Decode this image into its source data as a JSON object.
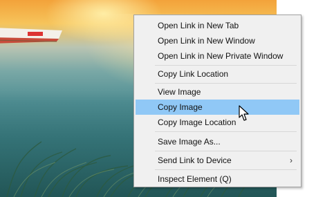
{
  "background_photo": {
    "description_color_sky": "#f3a23a",
    "description_color_water": "#3c7f84"
  },
  "context_menu": {
    "items": [
      {
        "label": "Open Link in New Tab"
      },
      {
        "label": "Open Link in New Window"
      },
      {
        "label": "Open Link in New Private Window"
      },
      {
        "label": "Copy Link Location"
      },
      {
        "label": "View Image"
      },
      {
        "label": "Copy Image",
        "highlighted": true
      },
      {
        "label": "Copy Image Location"
      },
      {
        "label": "Save Image As..."
      },
      {
        "label": "Send Link to Device",
        "submenu_arrow": "›"
      },
      {
        "label": "Inspect Element (Q)"
      }
    ],
    "highlight_color": "#90c8f6"
  },
  "cursor": {
    "icon": "arrow-pointer-icon"
  }
}
